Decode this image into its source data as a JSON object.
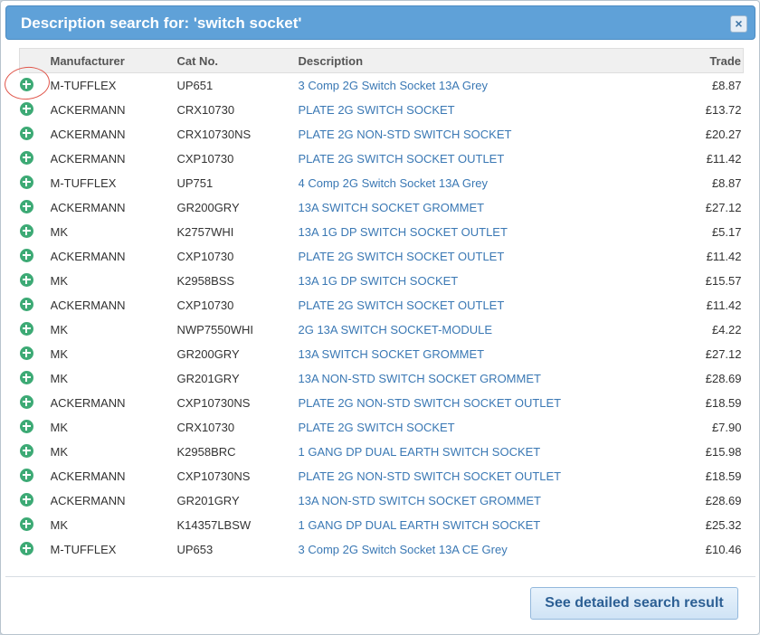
{
  "dialog": {
    "title": "Description search for: 'switch socket'",
    "close_label": "×"
  },
  "table": {
    "headers": {
      "manufacturer": "Manufacturer",
      "cat_no": "Cat No.",
      "description": "Description",
      "trade": "Trade"
    },
    "rows": [
      {
        "manufacturer": "M-TUFFLEX",
        "cat_no": "UP651",
        "description": "3 Comp 2G Switch Socket 13A Grey",
        "trade": "£8.87"
      },
      {
        "manufacturer": "ACKERMANN",
        "cat_no": "CRX10730",
        "description": "PLATE 2G SWITCH SOCKET",
        "trade": "£13.72"
      },
      {
        "manufacturer": "ACKERMANN",
        "cat_no": "CRX10730NS",
        "description": "PLATE 2G NON-STD SWITCH SOCKET",
        "trade": "£20.27"
      },
      {
        "manufacturer": "ACKERMANN",
        "cat_no": "CXP10730",
        "description": "PLATE 2G SWITCH SOCKET OUTLET",
        "trade": "£11.42"
      },
      {
        "manufacturer": "M-TUFFLEX",
        "cat_no": "UP751",
        "description": "4 Comp 2G Switch Socket 13A Grey",
        "trade": "£8.87"
      },
      {
        "manufacturer": "ACKERMANN",
        "cat_no": "GR200GRY",
        "description": "13A SWITCH SOCKET GROMMET",
        "trade": "£27.12"
      },
      {
        "manufacturer": "MK",
        "cat_no": "K2757WHI",
        "description": "13A 1G DP SWITCH SOCKET OUTLET",
        "trade": "£5.17"
      },
      {
        "manufacturer": "ACKERMANN",
        "cat_no": "CXP10730",
        "description": "PLATE 2G SWITCH SOCKET OUTLET",
        "trade": "£11.42"
      },
      {
        "manufacturer": "MK",
        "cat_no": "K2958BSS",
        "description": "13A 1G DP SWITCH SOCKET",
        "trade": "£15.57"
      },
      {
        "manufacturer": "ACKERMANN",
        "cat_no": "CXP10730",
        "description": "PLATE 2G SWITCH SOCKET OUTLET",
        "trade": "£11.42"
      },
      {
        "manufacturer": "MK",
        "cat_no": "NWP7550WHI",
        "description": "2G 13A SWITCH SOCKET-MODULE",
        "trade": "£4.22"
      },
      {
        "manufacturer": "MK",
        "cat_no": "GR200GRY",
        "description": "13A SWITCH SOCKET GROMMET",
        "trade": "£27.12"
      },
      {
        "manufacturer": "MK",
        "cat_no": "GR201GRY",
        "description": "13A NON-STD SWITCH SOCKET GROMMET",
        "trade": "£28.69"
      },
      {
        "manufacturer": "ACKERMANN",
        "cat_no": "CXP10730NS",
        "description": "PLATE 2G NON-STD SWITCH SOCKET OUTLET",
        "trade": "£18.59"
      },
      {
        "manufacturer": "MK",
        "cat_no": "CRX10730",
        "description": "PLATE 2G SWITCH SOCKET",
        "trade": "£7.90"
      },
      {
        "manufacturer": "MK",
        "cat_no": "K2958BRC",
        "description": "1 GANG DP DUAL EARTH SWITCH SOCKET",
        "trade": "£15.98"
      },
      {
        "manufacturer": "ACKERMANN",
        "cat_no": "CXP10730NS",
        "description": "PLATE 2G NON-STD SWITCH SOCKET OUTLET",
        "trade": "£18.59"
      },
      {
        "manufacturer": "ACKERMANN",
        "cat_no": "GR201GRY",
        "description": "13A NON-STD SWITCH SOCKET GROMMET",
        "trade": "£28.69"
      },
      {
        "manufacturer": "MK",
        "cat_no": "K14357LBSW",
        "description": "1 GANG DP DUAL EARTH SWITCH SOCKET",
        "trade": "£25.32"
      },
      {
        "manufacturer": "M-TUFFLEX",
        "cat_no": "UP653",
        "description": "3 Comp 2G Switch Socket 13A CE Grey",
        "trade": "£10.46"
      }
    ]
  },
  "footer": {
    "detail_button_label": "See detailed search result"
  },
  "colors": {
    "titlebar": "#5fa1d8",
    "link": "#3a78b4",
    "add_icon": "#3daa75",
    "highlight_ring": "#e0554a"
  },
  "icons": {
    "row_add": "plus-circle-icon",
    "close": "close-icon"
  }
}
